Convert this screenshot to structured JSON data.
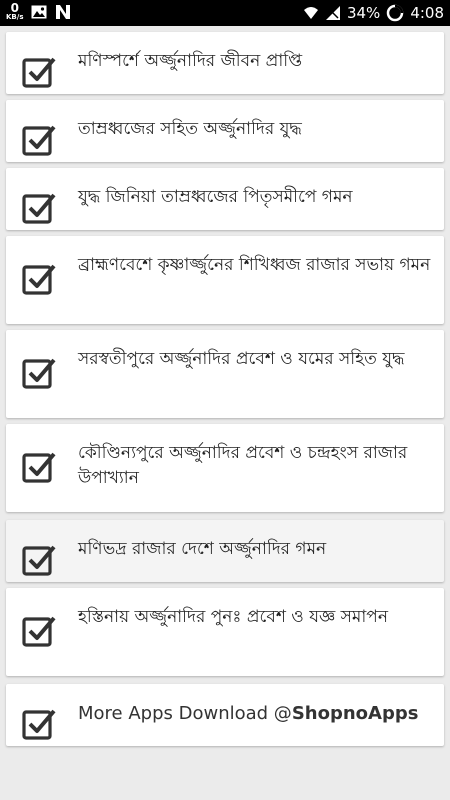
{
  "status_bar": {
    "net_speed_value": "0",
    "net_speed_unit": "KB/s",
    "icons_left": [
      "image-icon",
      "n-app-icon"
    ],
    "icons_right": [
      "wifi-icon",
      "signal-icon"
    ],
    "battery": "34%",
    "time": "4:08"
  },
  "chapters": [
    {
      "title": "মণিস্পর্শে অর্জ্জুনাদির জীবন প্রাপ্তি",
      "checked": true
    },
    {
      "title": "তাম্রধ্বজের সহিত অর্জ্জুনাদির যুদ্ধ",
      "checked": true
    },
    {
      "title": "যুদ্ধ জিনিয়া তাম্রধ্বজের পিতৃসমীপে গমন",
      "checked": true
    },
    {
      "title": "ব্রাহ্মণবেশে কৃষ্ণার্জ্জুনের শিখিধ্বজ রাজার সভায় গমন",
      "checked": true
    },
    {
      "title": "সরস্বতীপুরে অর্জ্জুনাদির প্রবেশ ও যমের সহিত যুদ্ধ",
      "checked": true
    },
    {
      "title": "কৌণ্ডিন্যপুরে অর্জ্জুনাদির প্রবেশ ও চন্দ্রহংস রাজার উপাখ্যান",
      "checked": true
    },
    {
      "title": "মণিভদ্র রাজার দেশে অর্জ্জুনাদির গমন",
      "checked": true
    },
    {
      "title": "হস্তিনায় অর্জ্জুনাদির পুনঃ প্রবেশ ও যজ্ঞ সমাপন",
      "checked": true
    }
  ],
  "more_apps": {
    "prefix": "More Apps Download @",
    "brand": "ShopnoApps"
  },
  "colors": {
    "background": "#ebebeb",
    "card": "#ffffff",
    "check": "#333333"
  }
}
